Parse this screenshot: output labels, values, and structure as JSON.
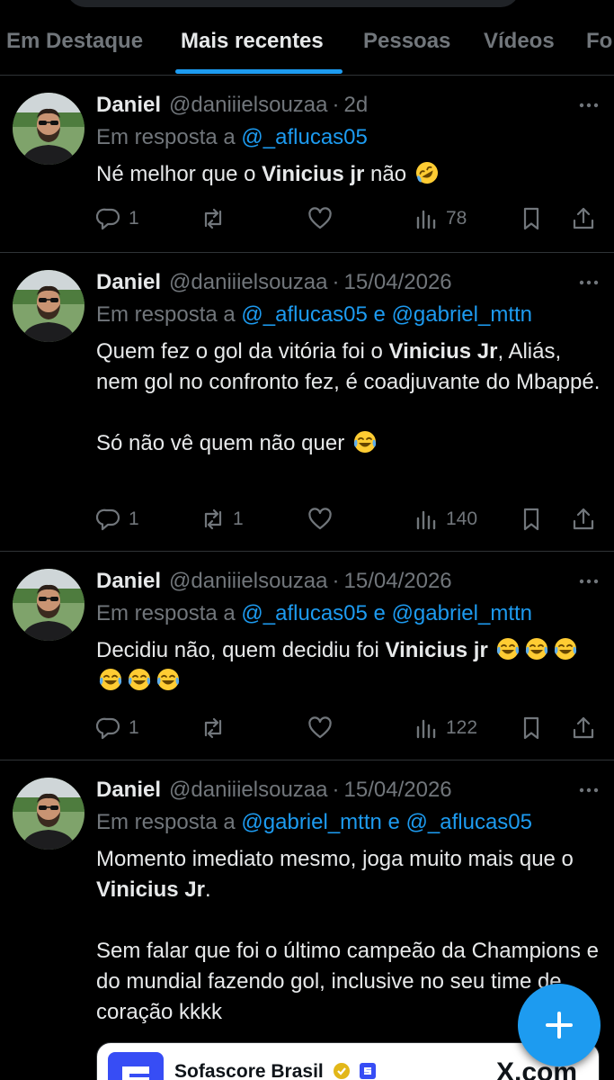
{
  "tabs": [
    {
      "label": "Em Destaque"
    },
    {
      "label": "Mais recentes",
      "active": true
    },
    {
      "label": "Pessoas"
    },
    {
      "label": "Vídeos"
    },
    {
      "label": "Fo"
    }
  ],
  "tweets": [
    {
      "name": "Daniel",
      "handle": "@daniiielsouzaa",
      "sep": "·",
      "date": "2d",
      "reply_prefix": "Em resposta a",
      "reply_mentions": [
        "@_aflucas05"
      ],
      "reply_joiner": "",
      "text": [
        {
          "t": "Né melhor que o "
        },
        {
          "b": "Vinicius jr"
        },
        {
          "t": " não "
        },
        {
          "emoji": "rolling-on-floor-laughing"
        }
      ],
      "stats": {
        "replies": "1",
        "retweets": "",
        "likes": "",
        "views": "78"
      }
    },
    {
      "name": "Daniel",
      "handle": "@daniiielsouzaa",
      "sep": "·",
      "date": "15/04/2026",
      "reply_prefix": "Em resposta a",
      "reply_mentions": [
        "@_aflucas05",
        "@gabriel_mttn"
      ],
      "reply_joiner": "e",
      "text": [
        {
          "t": "Quem fez o gol da vitória foi o "
        },
        {
          "b": "Vinicius Jr"
        },
        {
          "t": ", Aliás, nem gol no confronto fez, é coadjuvante do Mbappé."
        },
        {
          "br": 2
        },
        {
          "t": "Só não vê quem não quer "
        },
        {
          "emoji": "face-with-tears-of-joy"
        }
      ],
      "stats": {
        "replies": "1",
        "retweets": "1",
        "likes": "",
        "views": "140"
      }
    },
    {
      "name": "Daniel",
      "handle": "@daniiielsouzaa",
      "sep": "·",
      "date": "15/04/2026",
      "reply_prefix": "Em resposta a",
      "reply_mentions": [
        "@_aflucas05",
        "@gabriel_mttn"
      ],
      "reply_joiner": "e",
      "text": [
        {
          "t": "Decidiu não, quem decidiu foi "
        },
        {
          "b": "Vinicius jr"
        },
        {
          "t": " "
        },
        {
          "emoji": "face-with-tears-of-joy"
        },
        {
          "emoji": "face-with-tears-of-joy"
        },
        {
          "emoji": "face-with-tears-of-joy"
        },
        {
          "emoji": "face-with-tears-of-joy"
        },
        {
          "emoji": "face-with-tears-of-joy"
        },
        {
          "emoji": "face-with-tears-of-joy"
        }
      ],
      "stats": {
        "replies": "1",
        "retweets": "",
        "likes": "",
        "views": "122"
      }
    },
    {
      "name": "Daniel",
      "handle": "@daniiielsouzaa",
      "sep": "·",
      "date": "15/04/2026",
      "reply_prefix": "Em resposta a",
      "reply_mentions": [
        "@gabriel_mttn",
        "@_aflucas05"
      ],
      "reply_joiner": "e",
      "text": [
        {
          "t": "Momento imediato mesmo, joga muito mais que o "
        },
        {
          "b": "Vinicius Jr"
        },
        {
          "t": "."
        },
        {
          "br": 2
        },
        {
          "t": "Sem falar que foi o último campeão da Champions e do mundial fazendo gol, inclusive no seu time de coração kkkk"
        }
      ],
      "stats": null,
      "quoted_card": {
        "account": "Sofascore Brasil",
        "source": "X.com"
      }
    }
  ],
  "colors": {
    "accent": "#1d9bf0",
    "muted": "#71767b",
    "text": "#e7e9ea",
    "border": "#2f3336",
    "background": "#000000"
  },
  "icons": {
    "reply": "speech-bubble-icon",
    "retweet": "retweet-arrows-icon",
    "like": "heart-icon",
    "views": "bar-chart-icon",
    "bookmark": "bookmark-icon",
    "share": "share-upload-icon",
    "more": "more-dots-icon",
    "compose": "plus-icon"
  }
}
